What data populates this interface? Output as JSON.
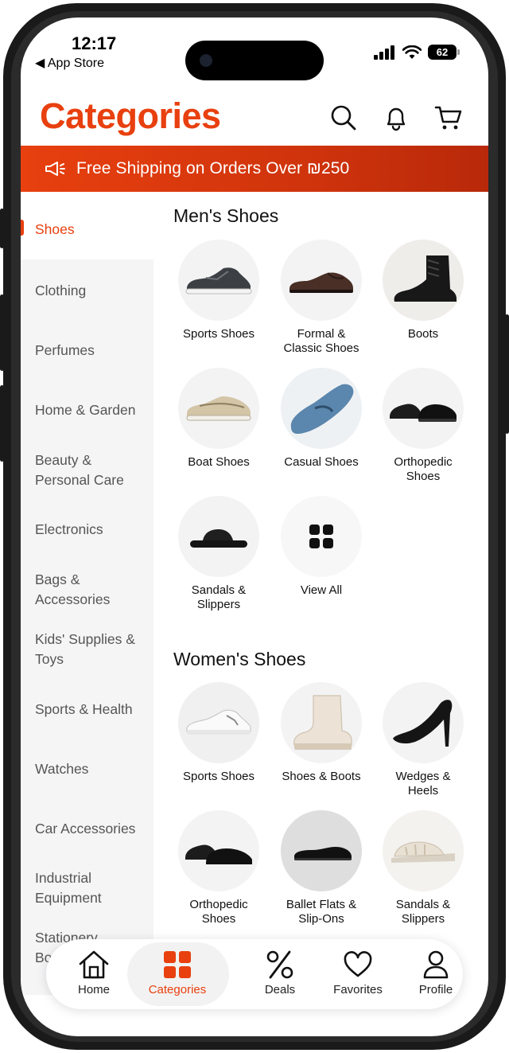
{
  "status_bar": {
    "time": "12:17",
    "back_app": "◀ App Store",
    "battery": "62"
  },
  "header": {
    "title": "Categories",
    "accent_color": "#e8400f"
  },
  "promo_banner": {
    "text": "Free Shipping on Orders Over ₪250",
    "icon": "megaphone-icon"
  },
  "sidebar": {
    "items": [
      {
        "label": "Shoes",
        "active": true
      },
      {
        "label": "Clothing"
      },
      {
        "label": "Perfumes"
      },
      {
        "label": "Home & Garden"
      },
      {
        "label": "Beauty &\nPersonal Care"
      },
      {
        "label": "Electronics"
      },
      {
        "label": "Bags &\nAccessories"
      },
      {
        "label": "Kids' Supplies &\nToys"
      },
      {
        "label": "Sports & Health"
      },
      {
        "label": "Watches"
      },
      {
        "label": "Car Accessories"
      },
      {
        "label": "Industrial\nEquipment"
      },
      {
        "label": "Stationery\nBo"
      }
    ]
  },
  "sections": [
    {
      "title": "Men's Shoes",
      "categories": [
        {
          "label": "Sports Shoes",
          "icon": "sports-shoe-icon"
        },
        {
          "label": "Formal &\nClassic Shoes",
          "icon": "formal-shoe-icon"
        },
        {
          "label": "Boots",
          "icon": "boot-icon"
        },
        {
          "label": "Boat Shoes",
          "icon": "boat-shoe-icon"
        },
        {
          "label": "Casual Shoes",
          "icon": "loafer-icon"
        },
        {
          "label": "Orthopedic\nShoes",
          "icon": "clog-icon"
        },
        {
          "label": "Sandals &\nSlippers",
          "icon": "slide-icon"
        },
        {
          "label": "View All",
          "icon": "grid-icon"
        }
      ]
    },
    {
      "title": "Women's Shoes",
      "categories": [
        {
          "label": "Sports Shoes",
          "icon": "sneaker-icon"
        },
        {
          "label": "Shoes & Boots",
          "icon": "ankle-boot-icon"
        },
        {
          "label": "Wedges &\nHeels",
          "icon": "heel-icon"
        },
        {
          "label": "Orthopedic\nShoes",
          "icon": "clog-icon"
        },
        {
          "label": "Ballet Flats &\nSlip-Ons",
          "icon": "flat-icon"
        },
        {
          "label": "Sandals &\nSlippers",
          "icon": "slide-icon"
        }
      ]
    }
  ],
  "tab_bar": {
    "tabs": [
      {
        "label": "Home",
        "icon": "home-icon"
      },
      {
        "label": "Categories",
        "icon": "categories-icon",
        "active": true
      },
      {
        "label": "Deals",
        "icon": "percent-icon"
      },
      {
        "label": "Favorites",
        "icon": "heart-icon"
      },
      {
        "label": "Profile",
        "icon": "person-icon"
      }
    ]
  }
}
